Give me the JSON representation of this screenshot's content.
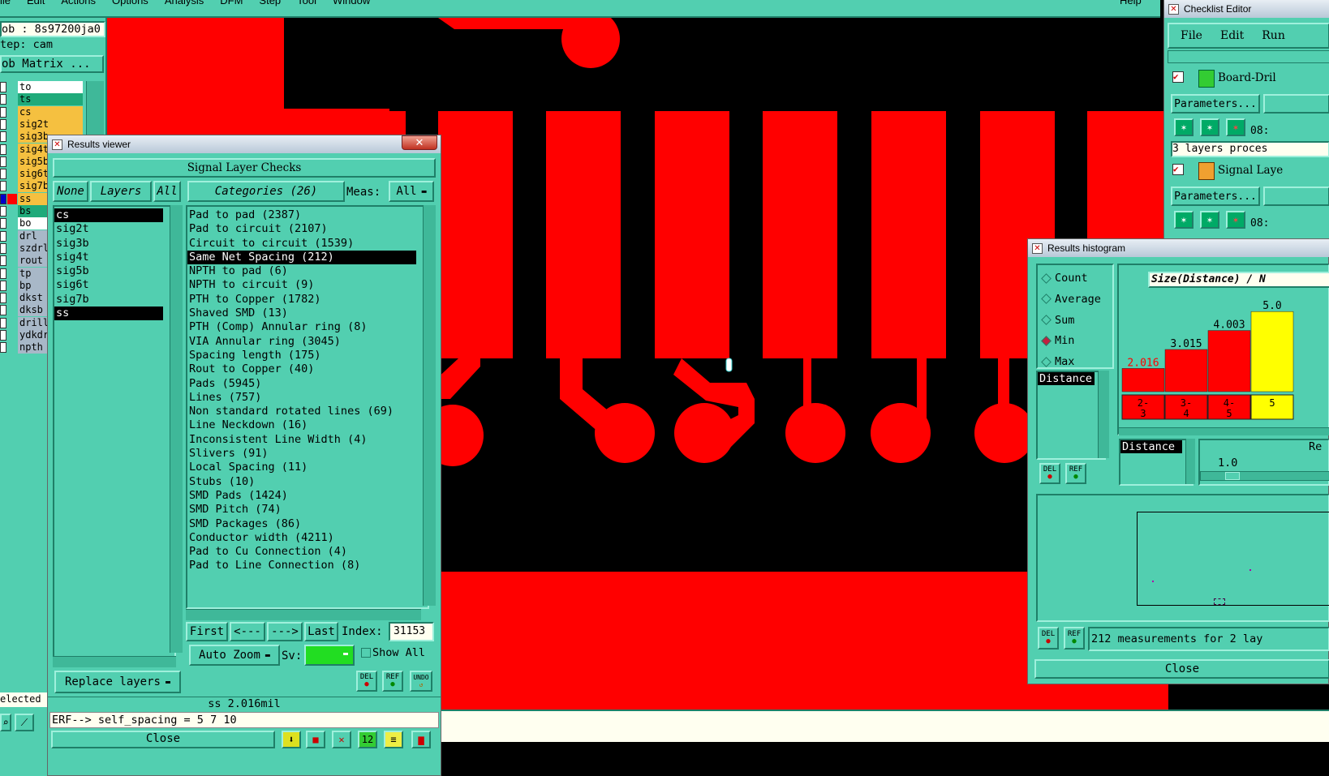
{
  "menubar": {
    "items": [
      "File",
      "Edit",
      "Actions",
      "Options",
      "Analysis",
      "DFM",
      "Step",
      "Tool",
      "Window"
    ],
    "help": "Help"
  },
  "left_panel": {
    "job_label": "ob : 8s97200ja0",
    "step_label": "tep: cam",
    "matrix_button": "ob Matrix ...",
    "layers": [
      {
        "name": "to",
        "bg": "#ffffff"
      },
      {
        "name": "ts",
        "bg": "#1faa7a"
      },
      {
        "name": "cs",
        "bg": "#f5c040"
      },
      {
        "name": "sig2t",
        "bg": "#f5c040"
      },
      {
        "name": "sig3b",
        "bg": "#f5c040"
      },
      {
        "name": "sig4t",
        "bg": "#f5c040"
      },
      {
        "name": "sig5b",
        "bg": "#f5c040"
      },
      {
        "name": "sig6t",
        "bg": "#f5c040"
      },
      {
        "name": "sig7b",
        "bg": "#f5c040"
      },
      {
        "name": "ss",
        "bg": "#f5c040"
      },
      {
        "name": "bs",
        "bg": "#1faa7a"
      },
      {
        "name": "bo",
        "bg": "#ffffff"
      },
      {
        "name": "drl",
        "bg": "#a8b8c8"
      },
      {
        "name": "szdrl",
        "bg": "#a8b8c8"
      },
      {
        "name": "rout",
        "bg": "#a8b8c8"
      },
      {
        "name": "tp",
        "bg": "#a8b8c8"
      },
      {
        "name": "bp",
        "bg": "#a8b8c8"
      },
      {
        "name": "dkst",
        "bg": "#a8b8c8"
      },
      {
        "name": "dksb",
        "bg": "#a8b8c8"
      },
      {
        "name": "drill",
        "bg": "#a8b8c8"
      },
      {
        "name": "ydkdr",
        "bg": "#a8b8c8"
      },
      {
        "name": "npth",
        "bg": "#a8b8c8"
      }
    ],
    "selected_label": "elected :"
  },
  "results_viewer": {
    "window_title": "Results viewer",
    "header": "Signal Layer Checks",
    "none_btn": "None",
    "layers_btn": "Layers",
    "all_btn": "All",
    "categories_btn": "Categories (26)",
    "meas_label": "Meas:",
    "meas_value": "All",
    "layer_list": [
      "cs",
      "sig2t",
      "sig3b",
      "sig4t",
      "sig5b",
      "sig6t",
      "sig7b",
      "ss"
    ],
    "categories": [
      "Pad to pad (2387)",
      "Pad to circuit (2107)",
      "Circuit to circuit (1539)",
      "Same Net Spacing (212)",
      "NPTH to pad (6)",
      "NPTH to circuit (9)",
      "PTH to Copper (1782)",
      "Shaved SMD (13)",
      "PTH (Comp) Annular ring (8)",
      "VIA Annular ring (3045)",
      "Spacing length (175)",
      "Rout to Copper (40)",
      "Pads (5945)",
      "Lines (757)",
      "Non standard rotated lines (69)",
      "Line Neckdown (16)",
      "Inconsistent Line Width (4)",
      "Slivers (91)",
      "Local Spacing (11)",
      "Stubs (10)",
      "SMD Pads (1424)",
      "SMD Pitch (74)",
      "SMD Packages (86)",
      "Conductor width (4211)",
      "Pad to Cu Connection (4)",
      "Pad to Line Connection (8)"
    ],
    "first_btn": "First",
    "prev_btn": "<---",
    "next_btn": "--->",
    "last_btn": "Last",
    "index_label": "Index:",
    "index_value": "31153",
    "auto_zoom_btn": "Auto Zoom",
    "sv_label": "Sv:",
    "show_all_label": "Show All",
    "replace_layers_btn": "Replace layers",
    "del_btn": "DEL",
    "ref_btn": "REF",
    "undo_btn": "UNDO",
    "status_measure": "ss 2.016mil",
    "erf_line": "ERF--> self_spacing = 5 7 10",
    "close_btn": "Close"
  },
  "checklist_editor": {
    "window_title": "Checklist Editor",
    "menu": [
      "File",
      "Edit",
      "Run"
    ],
    "action1_name": "Board-Dril",
    "params_btn": "Parameters...",
    "time1": "08:",
    "status1": "3 layers proces",
    "action2_name": "Signal Laye",
    "time2": "08:"
  },
  "results_histogram": {
    "window_title": "Results histogram",
    "modes": [
      "Count",
      "Average",
      "Sum",
      "Min",
      "Max"
    ],
    "selected_mode": "Min",
    "size_label": "Size(Distance) / N",
    "measure_list": [
      "Distance"
    ],
    "bars": [
      {
        "value": "2.016",
        "range": "2-\n3",
        "fraction": 0.22,
        "color": "#ff0000",
        "label_color": "#ff0000"
      },
      {
        "value": "3.015",
        "range": "3-\n4",
        "fraction": 0.4,
        "color": "#ff0000",
        "label_color": "#000000"
      },
      {
        "value": "4.003",
        "range": "4-\n5",
        "fraction": 0.58,
        "color": "#ff0000",
        "label_color": "#000000"
      },
      {
        "value": "5.0",
        "range": "5",
        "fraction": 0.76,
        "color": "#ffff00",
        "label_color": "#000000"
      }
    ],
    "distance_label": "Distance",
    "re_label": "Re",
    "scale_value": "1.0",
    "summary": "212 measurements for 2 lay",
    "close_btn": "Close"
  },
  "colors": {
    "copper": "#ff0000",
    "background": "#000000",
    "panel": "#52cfb0",
    "cream": "#fffff0"
  }
}
